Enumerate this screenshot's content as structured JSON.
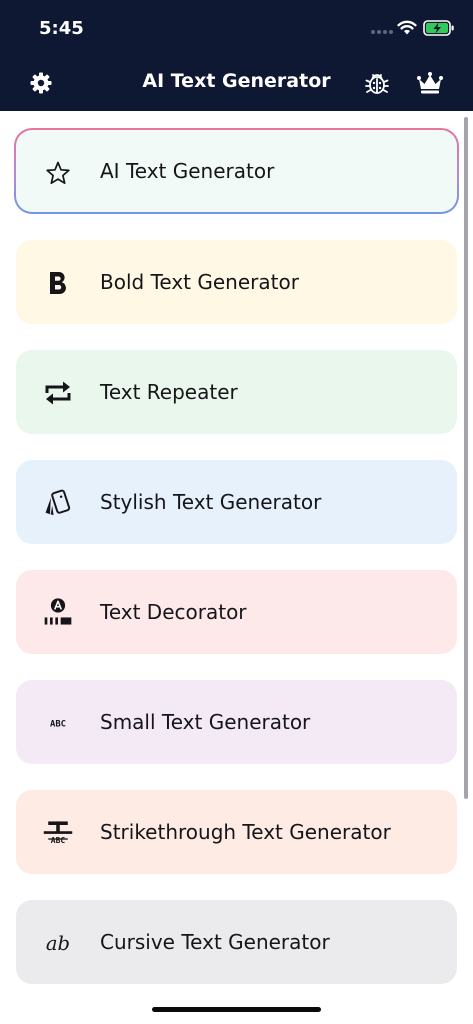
{
  "status_bar": {
    "time": "5:45"
  },
  "header": {
    "title": "AI Text Generator",
    "icons": {
      "settings": "gear-icon",
      "bug": "bug-icon",
      "premium": "crown-icon"
    }
  },
  "tools": [
    {
      "label": "AI Text Generator",
      "icon": "star-icon",
      "bg": "#f1faf6"
    },
    {
      "label": "Bold Text Generator",
      "icon": "bold-icon",
      "bg": "#fff8e5"
    },
    {
      "label": "Text Repeater",
      "icon": "repeat-icon",
      "bg": "#e9f7ed"
    },
    {
      "label": "Stylish Text Generator",
      "icon": "stylish-cards-icon",
      "bg": "#e7f1fb"
    },
    {
      "label": "Text Decorator",
      "icon": "decorator-icon",
      "bg": "#fde9ea"
    },
    {
      "label": "Small Text Generator",
      "icon": "small-text-icon",
      "bg": "#f4eaf5"
    },
    {
      "label": "Strikethrough Text Generator",
      "icon": "strikethrough-icon",
      "bg": "#fdebe4"
    },
    {
      "label": "Cursive Text Generator",
      "icon": "cursive-icon",
      "bg": "#ebebed"
    }
  ],
  "small_icon_text": "ABC",
  "cursive_icon_text": "ab",
  "colors": {
    "header_bg": "#0e1832",
    "highlight_gradient_top": "#e7739f",
    "highlight_gradient_bottom": "#6e97e5",
    "battery_green": "#34c759"
  }
}
